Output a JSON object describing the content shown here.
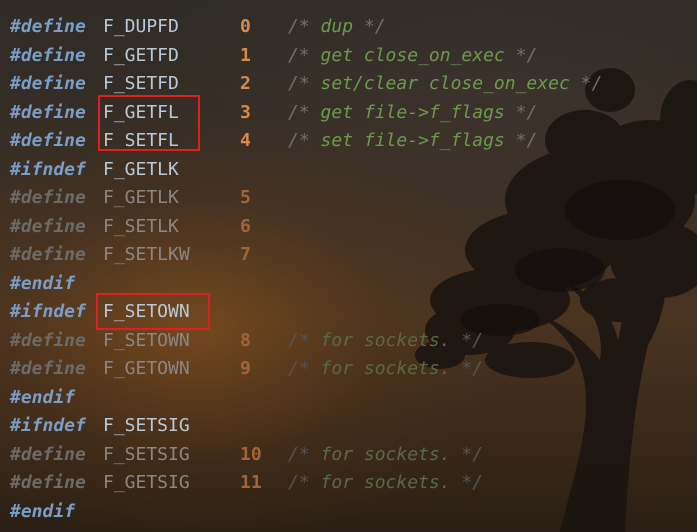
{
  "highlight_color": "#e02020",
  "lines": [
    {
      "kw": "#define",
      "name": "F_DUPFD",
      "num": "0",
      "comment": "dup",
      "dim": false
    },
    {
      "kw": "#define",
      "name": "F_GETFD",
      "num": "1",
      "comment": "get close_on_exec",
      "dim": false
    },
    {
      "kw": "#define",
      "name": "F_SETFD",
      "num": "2",
      "comment": "set/clear close_on_exec",
      "dim": false
    },
    {
      "kw": "#define",
      "name": "F_GETFL",
      "num": "3",
      "comment": "get file->f_flags",
      "dim": false
    },
    {
      "kw": "#define",
      "name": "F_SETFL",
      "num": "4",
      "comment": "set file->f_flags",
      "dim": false
    },
    {
      "kw": "#ifndef",
      "name": "F_GETLK",
      "num": "",
      "comment": "",
      "dim": false
    },
    {
      "kw": "#define",
      "name": "F_GETLK",
      "num": "5",
      "comment": "",
      "dim": true
    },
    {
      "kw": "#define",
      "name": "F_SETLK",
      "num": "6",
      "comment": "",
      "dim": true
    },
    {
      "kw": "#define",
      "name": "F_SETLKW",
      "num": "7",
      "comment": "",
      "dim": true
    },
    {
      "kw": "#endif",
      "name": "",
      "num": "",
      "comment": "",
      "dim": false
    },
    {
      "kw": "#ifndef",
      "name": "F_SETOWN",
      "num": "",
      "comment": "",
      "dim": false
    },
    {
      "kw": "#define",
      "name": "F_SETOWN",
      "num": "8",
      "comment": "for sockets.",
      "dim": true
    },
    {
      "kw": "#define",
      "name": "F_GETOWN",
      "num": "9",
      "comment": "for sockets.",
      "dim": true
    },
    {
      "kw": "#endif",
      "name": "",
      "num": "",
      "comment": "",
      "dim": false
    },
    {
      "kw": "#ifndef",
      "name": "F_SETSIG",
      "num": "",
      "comment": "",
      "dim": false
    },
    {
      "kw": "#define",
      "name": "F_SETSIG",
      "num": "10",
      "comment": "for sockets.",
      "dim": true
    },
    {
      "kw": "#define",
      "name": "F_GETSIG",
      "num": "11",
      "comment": "for sockets.",
      "dim": true
    },
    {
      "kw": "#endif",
      "name": "",
      "num": "",
      "comment": "",
      "dim": false
    }
  ],
  "comment_open": "/*",
  "comment_close": "*/"
}
